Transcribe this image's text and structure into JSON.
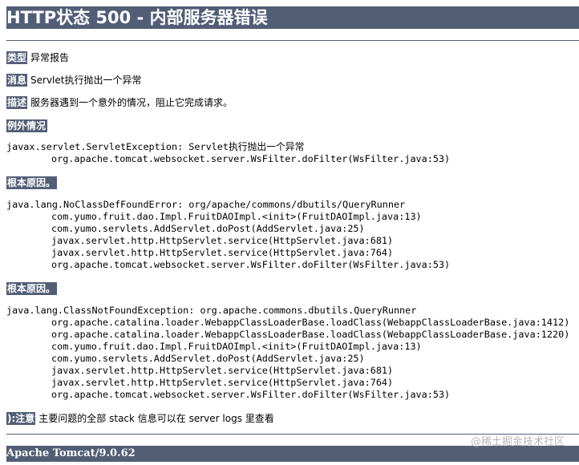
{
  "header": {
    "title": "HTTP状态 500 - 内部服务器错误"
  },
  "report": {
    "type_label": "类型",
    "type_value": "异常报告",
    "message_label": "消息",
    "message_value": "Servlet执行抛出一个异常",
    "description_label": "描述",
    "description_value": "服务器遇到一个意外的情况，阻止它完成请求。"
  },
  "exception": {
    "label": "例外情况",
    "lines": [
      "javax.servlet.ServletException: Servlet执行抛出一个异常",
      "org.apache.tomcat.websocket.server.WsFilter.doFilter(WsFilter.java:53)"
    ]
  },
  "root_cause_1": {
    "label": "根本原因。",
    "lines": [
      "java.lang.NoClassDefFoundError: org/apache/commons/dbutils/QueryRunner",
      "com.yumo.fruit.dao.Impl.FruitDAOImpl.<init>(FruitDAOImpl.java:13)",
      "com.yumo.servlets.AddServlet.doPost(AddServlet.java:25)",
      "javax.servlet.http.HttpServlet.service(HttpServlet.java:681)",
      "javax.servlet.http.HttpServlet.service(HttpServlet.java:764)",
      "org.apache.tomcat.websocket.server.WsFilter.doFilter(WsFilter.java:53)"
    ]
  },
  "root_cause_2": {
    "label": "根本原因。",
    "lines": [
      "java.lang.ClassNotFoundException: org.apache.commons.dbutils.QueryRunner",
      "org.apache.catalina.loader.WebappClassLoaderBase.loadClass(WebappClassLoaderBase.java:1412)",
      "org.apache.catalina.loader.WebappClassLoaderBase.loadClass(WebappClassLoaderBase.java:1220)",
      "com.yumo.fruit.dao.Impl.FruitDAOImpl.<init>(FruitDAOImpl.java:13)",
      "com.yumo.servlets.AddServlet.doPost(AddServlet.java:25)",
      "javax.servlet.http.HttpServlet.service(HttpServlet.java:681)",
      "javax.servlet.http.HttpServlet.service(HttpServlet.java:764)",
      "org.apache.tomcat.websocket.server.WsFilter.doFilter(WsFilter.java:53)"
    ]
  },
  "note": {
    "label": "):注意",
    "value": "主要问题的全部 stack 信息可以在 server logs 里查看"
  },
  "footer": {
    "server": "Apache Tomcat/9.0.62"
  },
  "watermark": {
    "text": "@稀土掘金技术社区"
  },
  "colors": {
    "tomcat_header": "#525d76",
    "label_text": "#ffffff",
    "body_text": "#000000",
    "watermark": "#aaaaaa"
  }
}
